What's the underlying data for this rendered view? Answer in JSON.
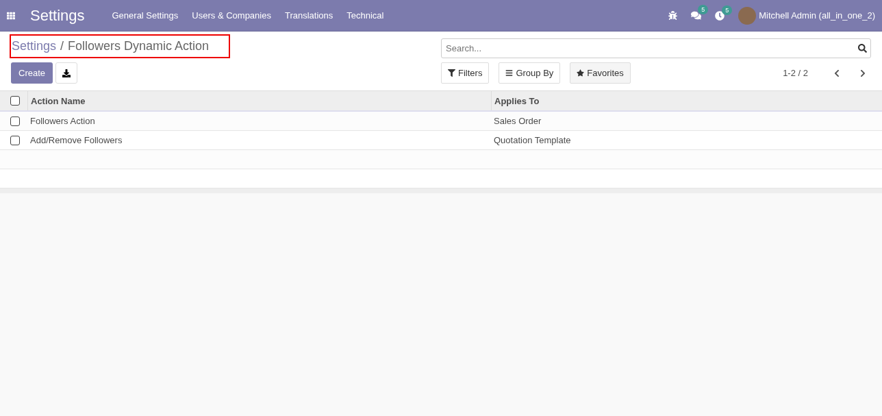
{
  "navbar": {
    "app_title": "Settings",
    "menu": [
      "General Settings",
      "Users & Companies",
      "Translations",
      "Technical"
    ],
    "messages_count": "5",
    "activities_count": "5",
    "user": "Mitchell Admin (all_in_one_2)"
  },
  "breadcrumb": {
    "parent": "Settings",
    "separator": "/",
    "current": "Followers Dynamic Action"
  },
  "buttons": {
    "create": "Create"
  },
  "search": {
    "placeholder": "Search..."
  },
  "filters": [
    "Filters",
    "Group By",
    "Favorites"
  ],
  "pager": "1-2 / 2",
  "table": {
    "select_all": {
      "checked": false
    },
    "columns": [
      "Action Name",
      "Applies To"
    ],
    "rows": [
      {
        "checked": false,
        "cells": [
          "Followers Action",
          "Sales Order"
        ]
      },
      {
        "checked": false,
        "cells": [
          "Add/Remove Followers",
          "Quotation Template"
        ]
      }
    ]
  }
}
